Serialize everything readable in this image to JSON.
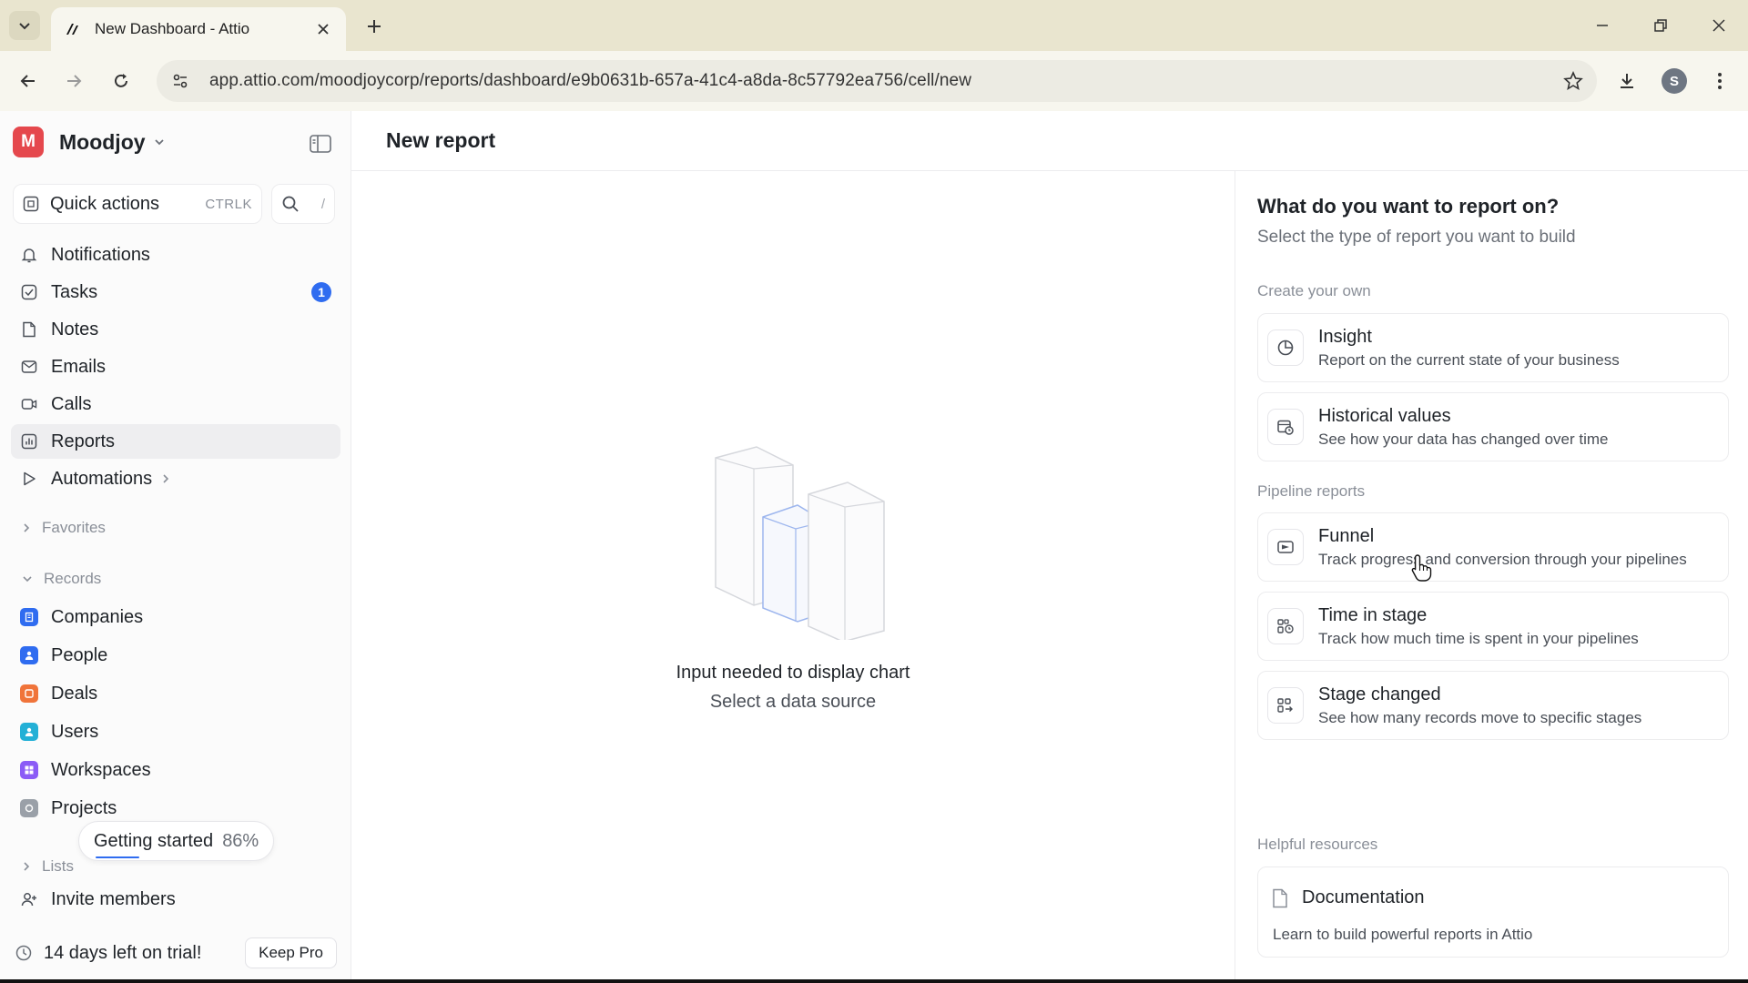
{
  "browser": {
    "tab_title": "New Dashboard - Attio",
    "url": "app.attio.com/moodjoycorp/reports/dashboard/e9b0631b-657a-41c4-a8da-8c57792ea756/cell/new",
    "profile_initial": "S"
  },
  "workspace": {
    "logo_letter": "M",
    "name": "Moodjoy",
    "logo_color": "#e5484d"
  },
  "quick_actions": {
    "label": "Quick actions",
    "shortcut": "CTRLK",
    "search_shortcut": "/"
  },
  "nav": {
    "notifications": "Notifications",
    "tasks": "Tasks",
    "tasks_badge": "1",
    "notes": "Notes",
    "emails": "Emails",
    "calls": "Calls",
    "reports": "Reports",
    "automations": "Automations"
  },
  "sections": {
    "favorites": "Favorites",
    "records": "Records",
    "lists": "Lists"
  },
  "records": [
    {
      "label": "Companies",
      "color": "#2f6cf0"
    },
    {
      "label": "People",
      "color": "#2f6cf0"
    },
    {
      "label": "Deals",
      "color": "#f0743a"
    },
    {
      "label": "Users",
      "color": "#23b0d6"
    },
    {
      "label": "Workspaces",
      "color": "#8b5cf6"
    },
    {
      "label": "Projects",
      "color": "#9aa0a8"
    }
  ],
  "getting_started": {
    "label": "Getting started",
    "percent": "86%"
  },
  "invite_members": "Invite members",
  "trial": {
    "text": "14 days left on trial!",
    "button": "Keep Pro"
  },
  "page": {
    "title": "New report"
  },
  "empty_state": {
    "title": "Input needed to display chart",
    "subtitle": "Select a data source"
  },
  "panel": {
    "title": "What do you want to report on?",
    "subtitle": "Select the type of report you want to build",
    "group_create": "Create your own",
    "group_pipeline": "Pipeline reports",
    "group_resources": "Helpful resources",
    "create_options": [
      {
        "title": "Insight",
        "desc": "Report on the current state of your business",
        "icon": "pie-chart-icon"
      },
      {
        "title": "Historical values",
        "desc": "See how your data has changed over time",
        "icon": "history-calendar-icon"
      }
    ],
    "pipeline_options": [
      {
        "title": "Funnel",
        "desc": "Track progress and conversion through your pipelines",
        "icon": "funnel-icon"
      },
      {
        "title": "Time in stage",
        "desc": "Track how much time is spent in your pipelines",
        "icon": "time-in-stage-icon"
      },
      {
        "title": "Stage changed",
        "desc": "See how many records move to specific stages",
        "icon": "stage-changed-icon"
      }
    ],
    "documentation": {
      "title": "Documentation",
      "desc": "Learn to build powerful reports in Attio"
    }
  }
}
